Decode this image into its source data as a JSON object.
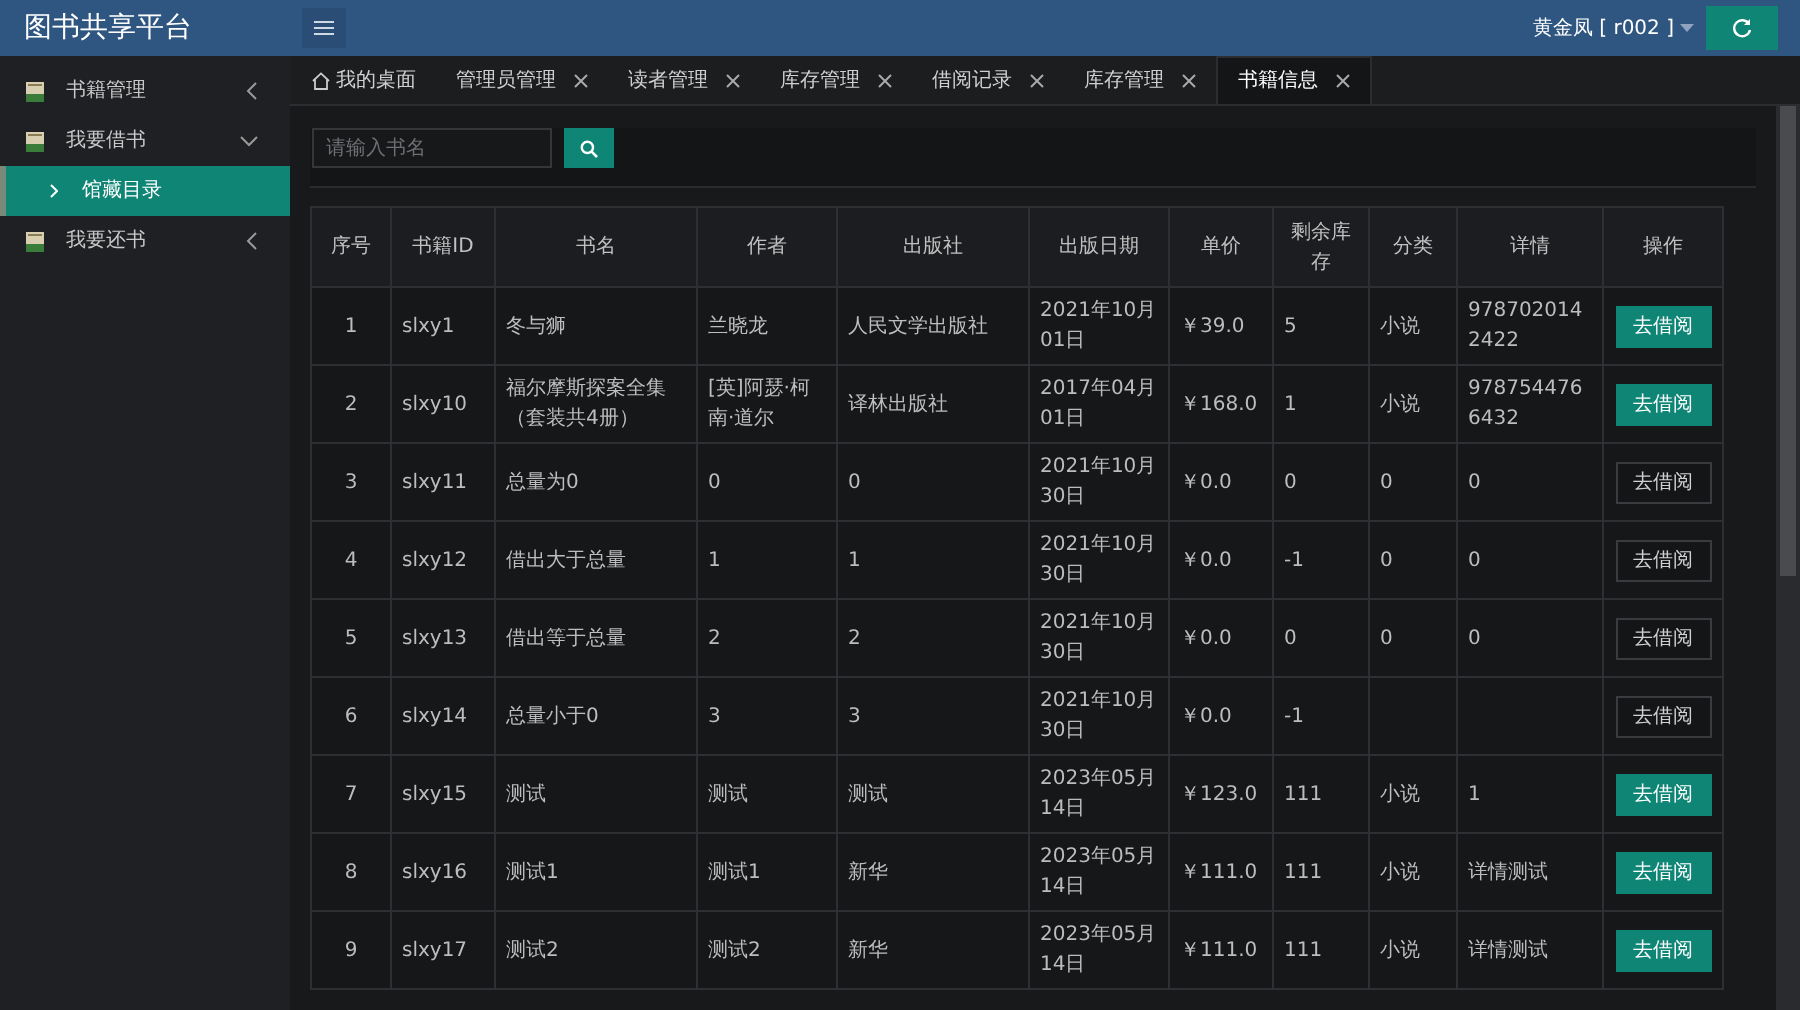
{
  "app": {
    "title": "图书共享平台",
    "user": "黄金凤 [ r002 ]"
  },
  "sidebar": {
    "items": [
      {
        "label": "书籍管理",
        "expanded": false
      },
      {
        "label": "我要借书",
        "expanded": true,
        "children": [
          {
            "label": "馆藏目录",
            "selected": true
          }
        ]
      },
      {
        "label": "我要还书",
        "expanded": false
      }
    ]
  },
  "tabs": [
    {
      "label": "我的桌面",
      "kind": "home",
      "selected": false
    },
    {
      "label": "管理员管理",
      "kind": "closable",
      "selected": false
    },
    {
      "label": "读者管理",
      "kind": "closable",
      "selected": false
    },
    {
      "label": "库存管理",
      "kind": "closable",
      "selected": false
    },
    {
      "label": "借阅记录",
      "kind": "closable",
      "selected": false
    },
    {
      "label": "库存管理",
      "kind": "closable",
      "selected": false
    },
    {
      "label": "书籍信息",
      "kind": "closable",
      "selected": true
    }
  ],
  "search": {
    "placeholder": "请输入书名"
  },
  "table": {
    "columns": [
      "序号",
      "书籍ID",
      "书名",
      "作者",
      "出版社",
      "出版日期",
      "单价",
      "剩余库存",
      "分类",
      "详情",
      "操作"
    ],
    "rows": [
      {
        "cells": [
          "1",
          "slxy1",
          "冬与狮",
          "兰晓龙",
          "人民文学出版社",
          "2021年10月01日",
          "￥39.0",
          "5",
          "小说",
          "9787020142422"
        ],
        "action": "去借阅",
        "available": true
      },
      {
        "cells": [
          "2",
          "slxy10",
          "福尔摩斯探案全集（套装共4册）",
          "[英]阿瑟·柯南·道尔",
          "译林出版社",
          "2017年04月01日",
          "￥168.0",
          "1",
          "小说",
          "9787544766432"
        ],
        "action": "去借阅",
        "available": true
      },
      {
        "cells": [
          "3",
          "slxy11",
          "总量为0",
          "0",
          "0",
          "2021年10月30日",
          "￥0.0",
          "0",
          "0",
          "0"
        ],
        "action": "去借阅",
        "available": false
      },
      {
        "cells": [
          "4",
          "slxy12",
          "借出大于总量",
          "1",
          "1",
          "2021年10月30日",
          "￥0.0",
          "-1",
          "0",
          "0"
        ],
        "action": "去借阅",
        "available": false
      },
      {
        "cells": [
          "5",
          "slxy13",
          "借出等于总量",
          "2",
          "2",
          "2021年10月30日",
          "￥0.0",
          "0",
          "0",
          "0"
        ],
        "action": "去借阅",
        "available": false
      },
      {
        "cells": [
          "6",
          "slxy14",
          "总量小于0",
          "3",
          "3",
          "2021年10月30日",
          "￥0.0",
          "-1",
          "",
          ""
        ],
        "action": "去借阅",
        "available": false
      },
      {
        "cells": [
          "7",
          "slxy15",
          "测试",
          "测试",
          "测试",
          "2023年05月14日",
          "￥123.0",
          "111",
          "小说",
          "1"
        ],
        "action": "去借阅",
        "available": true
      },
      {
        "cells": [
          "8",
          "slxy16",
          "测试1",
          "测试1",
          "新华",
          "2023年05月14日",
          "￥111.0",
          "111",
          "小说",
          "详情测试"
        ],
        "action": "去借阅",
        "available": true
      },
      {
        "cells": [
          "9",
          "slxy17",
          "测试2",
          "测试2",
          "新华",
          "2023年05月14日",
          "￥111.0",
          "111",
          "小说",
          "详情测试"
        ],
        "action": "去借阅",
        "available": true
      }
    ]
  }
}
